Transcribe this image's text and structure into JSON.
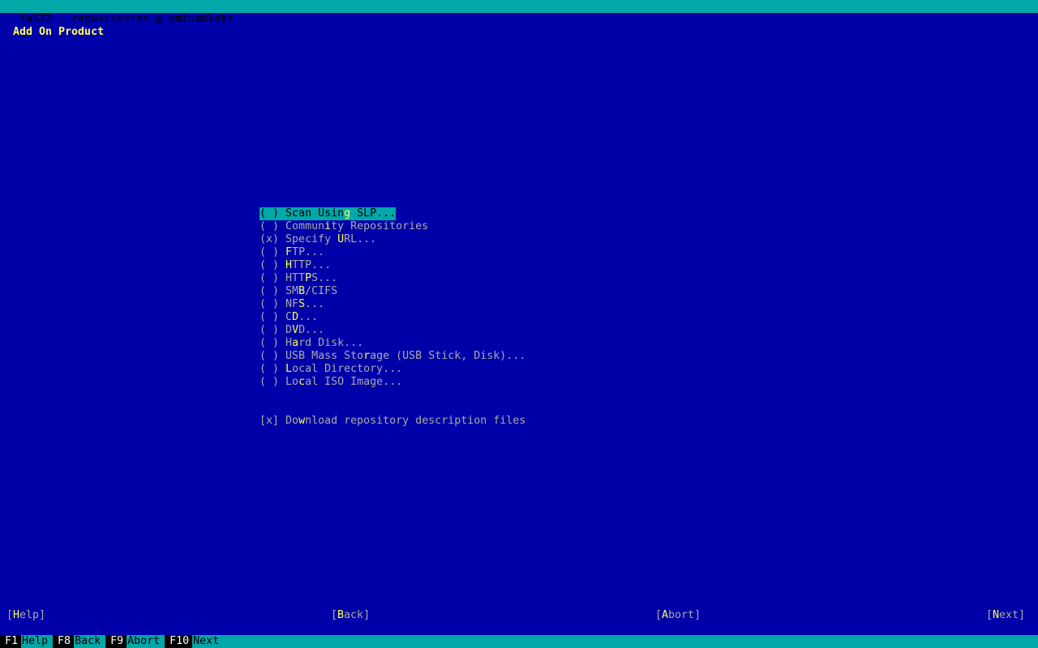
{
  "window": {
    "title": "YaST2 - repositories @ vmtumblekr"
  },
  "dialog": {
    "title": "Add On Product"
  },
  "options": [
    {
      "mark": "( )",
      "pre": "Scan Usin",
      "key": "g",
      "post": " SLP...",
      "selected": true
    },
    {
      "mark": "( )",
      "pre": "Commun",
      "key": "i",
      "post": "ty Repositories",
      "selected": false
    },
    {
      "mark": "(x)",
      "pre": "Specify ",
      "key": "U",
      "post": "RL...",
      "selected": false
    },
    {
      "mark": "( )",
      "pre": "",
      "key": "F",
      "post": "TP...",
      "selected": false
    },
    {
      "mark": "( )",
      "pre": "",
      "key": "H",
      "post": "TTP...",
      "selected": false
    },
    {
      "mark": "( )",
      "pre": "HTT",
      "key": "P",
      "post": "S...",
      "selected": false
    },
    {
      "mark": "( )",
      "pre": "SM",
      "key": "B",
      "post": "/CIFS",
      "selected": false
    },
    {
      "mark": "( )",
      "pre": "NF",
      "key": "S",
      "post": "...",
      "selected": false
    },
    {
      "mark": "( )",
      "pre": "C",
      "key": "D",
      "post": "...",
      "selected": false
    },
    {
      "mark": "( )",
      "pre": "D",
      "key": "V",
      "post": "D...",
      "selected": false
    },
    {
      "mark": "( )",
      "pre": "H",
      "key": "a",
      "post": "rd Disk...",
      "selected": false
    },
    {
      "mark": "( )",
      "pre": "USB Mass Sto",
      "key": "r",
      "post": "age (USB Stick, Disk)...",
      "selected": false
    },
    {
      "mark": "( )",
      "pre": "",
      "key": "L",
      "post": "ocal Directory...",
      "selected": false
    },
    {
      "mark": "( )",
      "pre": "Lo",
      "key": "c",
      "post": "al ISO Image...",
      "selected": false
    }
  ],
  "checkbox": {
    "mark": "[x]",
    "pre": "Do",
    "key": "w",
    "post": "nload repository description files"
  },
  "buttons": {
    "help": {
      "open": "[",
      "pre": "",
      "key": "H",
      "post": "elp",
      "close": "]"
    },
    "back": {
      "open": "[",
      "pre": "",
      "key": "B",
      "post": "ack",
      "close": "]"
    },
    "abort": {
      "open": "[",
      "pre": "",
      "key": "A",
      "post": "bort",
      "close": "]"
    },
    "next": {
      "open": "[",
      "pre": "",
      "key": "N",
      "post": "ext",
      "close": "]"
    }
  },
  "footer": [
    {
      "key": "F1",
      "label": "Help"
    },
    {
      "key": "F8",
      "label": "Back"
    },
    {
      "key": "F9",
      "label": "Abort"
    },
    {
      "key": "F10",
      "label": "Next"
    }
  ],
  "colors": {
    "background": "#0000a8",
    "bar": "#00a8a8",
    "text": "#aaaaaa",
    "hotkey": "#ffff54",
    "title": "#ffff54"
  }
}
